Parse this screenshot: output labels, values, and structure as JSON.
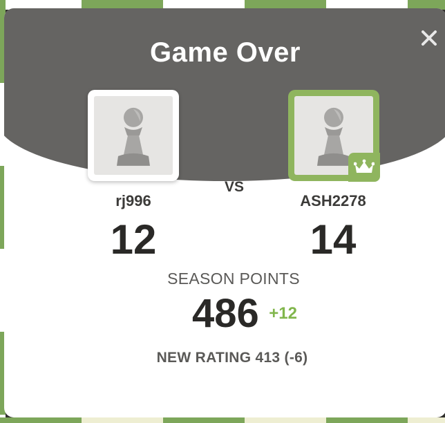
{
  "modal": {
    "title": "Game Over",
    "close_icon": "close-icon"
  },
  "players": {
    "left": {
      "username": "rj996",
      "score": "12",
      "avatar_icon": "pawn-icon",
      "is_winner": false
    },
    "right": {
      "username": "ASH2278",
      "score": "14",
      "avatar_icon": "pawn-icon",
      "is_winner": true,
      "badge_icon": "crown-icon"
    }
  },
  "versus_label": "VS",
  "season": {
    "label": "SEASON POINTS",
    "points": "486",
    "delta": "+12"
  },
  "rating_text": "NEW RATING 413 (-6)",
  "colors": {
    "header_gray": "#656462",
    "winner_green": "#8fb55e",
    "delta_green": "#81b64c",
    "text_dark": "#2a2927"
  }
}
